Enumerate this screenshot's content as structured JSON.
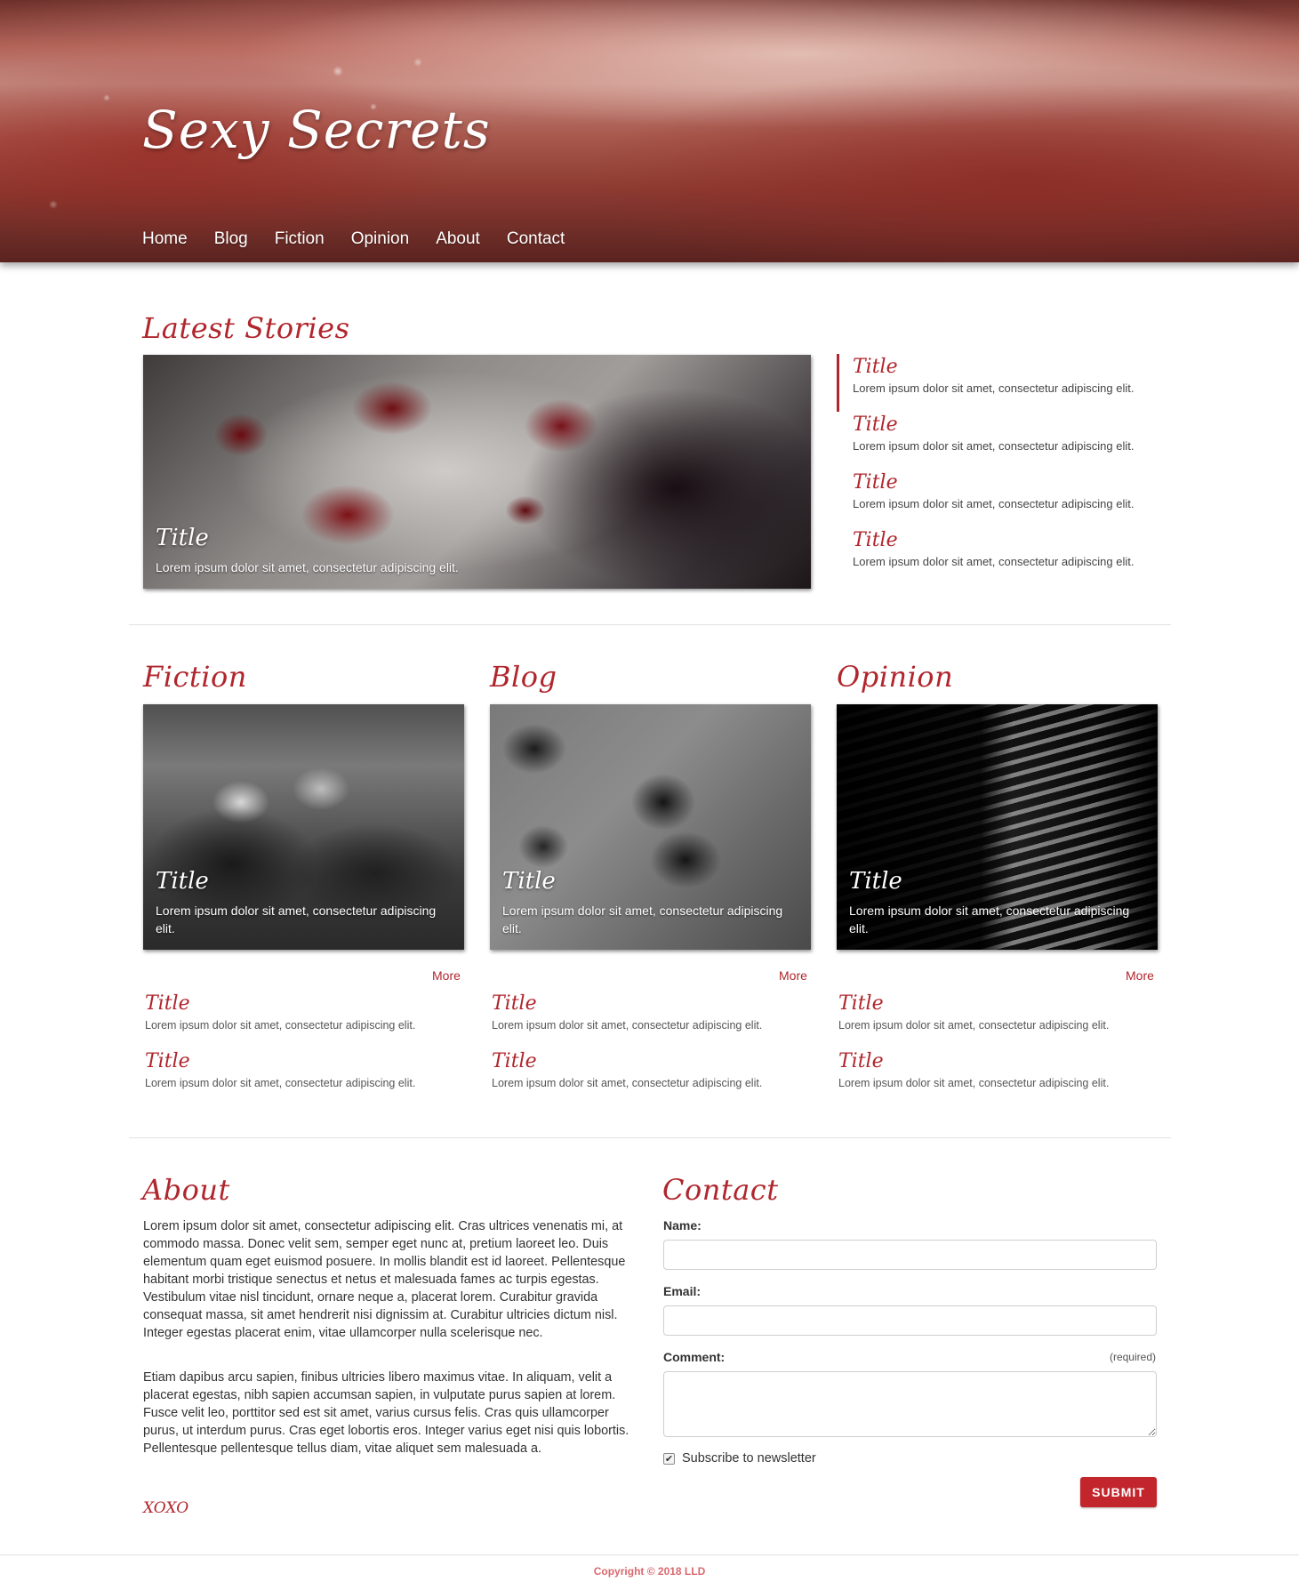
{
  "site": {
    "title": "Sexy Secrets",
    "accent": "#b0262d"
  },
  "nav": {
    "items": [
      "Home",
      "Blog",
      "Fiction",
      "Opinion",
      "About",
      "Contact"
    ]
  },
  "latest": {
    "heading": "Latest Stories",
    "feature": {
      "title": "Title",
      "text": "Lorem ipsum dolor sit amet, consectetur adipiscing elit."
    },
    "list": [
      {
        "title": "Title",
        "text": "Lorem ipsum dolor sit amet, consectetur adipiscing elit.",
        "active": true
      },
      {
        "title": "Title",
        "text": "Lorem ipsum dolor sit amet, consectetur adipiscing elit."
      },
      {
        "title": "Title",
        "text": "Lorem ipsum dolor sit amet, consectetur adipiscing elit."
      },
      {
        "title": "Title",
        "text": "Lorem ipsum dolor sit amet, consectetur adipiscing elit."
      }
    ]
  },
  "columns": [
    {
      "heading": "Fiction",
      "card": {
        "title": "Title",
        "text": "Lorem ipsum dolor sit amet, consectetur adipiscing elit."
      },
      "more": "More",
      "items": [
        {
          "title": "Title",
          "text": "Lorem ipsum dolor sit amet, consectetur adipiscing elit."
        },
        {
          "title": "Title",
          "text": "Lorem ipsum dolor sit amet, consectetur adipiscing elit."
        }
      ]
    },
    {
      "heading": "Blog",
      "card": {
        "title": "Title",
        "text": "Lorem ipsum dolor sit amet, consectetur adipiscing elit."
      },
      "more": "More",
      "items": [
        {
          "title": "Title",
          "text": "Lorem ipsum dolor sit amet, consectetur adipiscing elit."
        },
        {
          "title": "Title",
          "text": "Lorem ipsum dolor sit amet, consectetur adipiscing elit."
        }
      ]
    },
    {
      "heading": "Opinion",
      "card": {
        "title": "Title",
        "text": "Lorem ipsum dolor sit amet, consectetur adipiscing elit."
      },
      "more": "More",
      "items": [
        {
          "title": "Title",
          "text": "Lorem ipsum dolor sit amet, consectetur adipiscing elit."
        },
        {
          "title": "Title",
          "text": "Lorem ipsum dolor sit amet, consectetur adipiscing elit."
        }
      ]
    }
  ],
  "about": {
    "heading": "About",
    "paragraphs": [
      "Lorem ipsum dolor sit amet, consectetur adipiscing elit. Cras ultrices venenatis mi, at commodo massa. Donec velit sem, semper eget nunc at, pretium laoreet leo. Duis elementum quam eget euismod posuere. In mollis blandit est id laoreet. Pellentesque habitant morbi tristique senectus et netus et malesuada fames ac turpis egestas. Vestibulum vitae nisl tincidunt, ornare neque a, placerat lorem. Curabitur gravida consequat massa, sit amet hendrerit nisi dignissim at. Curabitur ultricies dictum nisl. Integer egestas placerat enim, vitae ullamcorper nulla scelerisque nec.",
      "Etiam dapibus arcu sapien, finibus ultricies libero maximus vitae. In aliquam, velit a placerat egestas, nibh sapien accumsan sapien, in vulputate purus sapien at lorem. Fusce velit leo, porttitor sed est sit amet, varius cursus felis. Cras quis ullamcorper purus, ut interdum purus. Cras eget lobortis eros. Integer varius eget nisi quis lobortis. Pellentesque pellentesque tellus diam, vitae aliquet sem malesuada a."
    ],
    "signoff": "XOXO"
  },
  "contact": {
    "heading": "Contact",
    "name_label": "Name:",
    "name_value": "",
    "email_label": "Email:",
    "email_value": "",
    "comment_label": "Comment:",
    "comment_required": "(required)",
    "comment_value": "",
    "subscribe_label": "Subscribe to newsletter",
    "subscribe_checked": true,
    "submit_label": "SUBMIT"
  },
  "footer": {
    "copyright": "Copyright © 2018 LLD"
  }
}
